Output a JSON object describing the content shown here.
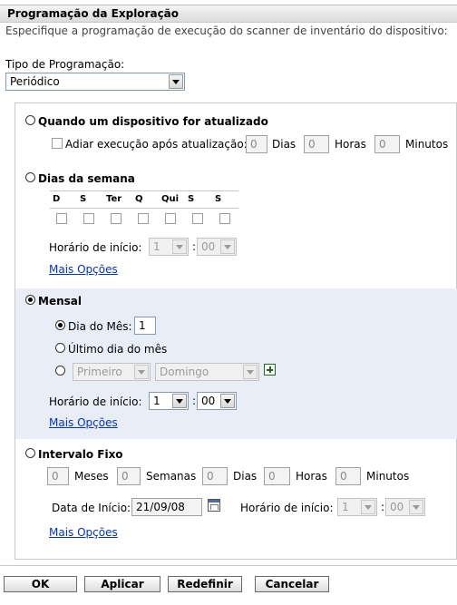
{
  "header": {
    "title": "Programação da Exploração",
    "description": "Especifique a programação de execução do scanner de inventário do dispositivo:"
  },
  "schedule_type": {
    "label": "Tipo de Programação:",
    "value": "Periódico"
  },
  "on_refresh": {
    "label": "Quando um dispositivo for atualizado",
    "delay_label": "Adiar execução após atualização:",
    "days_value": "0",
    "days_label": "Dias",
    "hours_value": "0",
    "hours_label": "Horas",
    "minutes_value": "0",
    "minutes_label": "Minutos"
  },
  "weekdays": {
    "label": "Dias da semana",
    "days": [
      "D",
      "S",
      "Ter",
      "Q",
      "Qui",
      "S",
      "S"
    ],
    "start_label": "Horário de início:",
    "hour": "1",
    "minute": "00",
    "more_options": "Mais Opções"
  },
  "monthly": {
    "label": "Mensal",
    "day_of_month_label": "Dia do Mês:",
    "day_of_month_value": "1",
    "last_day_label": "Último dia do mês",
    "ordinal_value": "Primeiro",
    "weekday_value": "Domingo",
    "start_label": "Horário de início:",
    "hour": "1",
    "minute": "00",
    "more_options": "Mais Opções"
  },
  "fixed_interval": {
    "label": "Intervalo Fixo",
    "months_value": "0",
    "months_label": "Meses",
    "weeks_value": "0",
    "weeks_label": "Semanas",
    "days_value": "0",
    "days_label": "Dias",
    "hours_value": "0",
    "hours_label": "Horas",
    "minutes_value": "0",
    "minutes_label": "Minutos",
    "start_date_label": "Data de Início:",
    "start_date_value": "21/09/08",
    "start_time_label": "Horário de início:",
    "hour": "1",
    "minute": "00",
    "more_options": "Mais Opções"
  },
  "buttons": {
    "ok": "OK",
    "apply": "Aplicar",
    "reset": "Redefinir",
    "cancel": "Cancelar"
  }
}
